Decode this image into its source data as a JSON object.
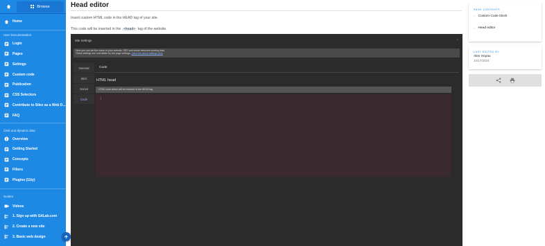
{
  "sidebar": {
    "browse_label": "Browse",
    "home_item": "Home",
    "sections": {
      "user_documentation": "User Documentation",
      "cms": "CMS and dynamic data",
      "guides": "Guides"
    },
    "user_docs_items": [
      {
        "label": "Login",
        "icon": "doc-icon"
      },
      {
        "label": "Pages",
        "icon": "doc-icon"
      },
      {
        "label": "Settings",
        "icon": "doc-icon"
      },
      {
        "label": "Custom code",
        "icon": "doc-icon"
      },
      {
        "label": "Publication",
        "icon": "doc-icon"
      },
      {
        "label": "CSS Selectors",
        "icon": "doc-icon"
      },
      {
        "label": "Contribute to Silex as a Web D...",
        "icon": "doc-icon"
      },
      {
        "label": "FAQ",
        "icon": "doc-icon"
      }
    ],
    "cms_items": [
      {
        "label": "Overview",
        "icon": "info-icon"
      },
      {
        "label": "Getting Started",
        "icon": "doc-icon"
      },
      {
        "label": "Concepts",
        "icon": "doc-icon"
      },
      {
        "label": "Filters",
        "icon": "doc-icon"
      },
      {
        "label": "Plugins (11ty)",
        "icon": "doc-icon"
      }
    ],
    "guide_items": [
      {
        "label": "Videos",
        "icon": "video-icon"
      },
      {
        "label": "1. Sign up with GitLab.com",
        "icon": "steps-icon"
      },
      {
        "label": "2. Create a new site",
        "icon": "steps-icon"
      },
      {
        "label": "3. Basic web design",
        "icon": "steps-icon"
      }
    ]
  },
  "main": {
    "title": "Head editor",
    "intro": "Insert custom HTML code in the HEAD tag of your site.",
    "line2_before": "This code will be inserted in the",
    "line2_code": "<head>",
    "line2_after": "tag of the website."
  },
  "screenshot": {
    "dialog_title": "Site Settings",
    "info_line1": "Here you can set the name of your website, SEO and social networks sharing data.",
    "info_line2": "These settings are overridden by the page settings.",
    "info_link": "more info about settings here",
    "tabs": [
      "General",
      "SEO",
      "Social",
      "Code"
    ],
    "active_tab": "Code",
    "panel_tab": "Code",
    "heading": "HTML head",
    "field_hint": "HTML code which will be inserted in the HEAD tag.",
    "line_number": "1"
  },
  "right": {
    "page_contents_heading": "PAGE CONTENTS",
    "toc": [
      "Custom Code block",
      "Head editor"
    ],
    "last_edited_heading": "LAST EDITED BY",
    "editor_name": "Alex Hoyau",
    "editor_date": "10/17/2024"
  }
}
